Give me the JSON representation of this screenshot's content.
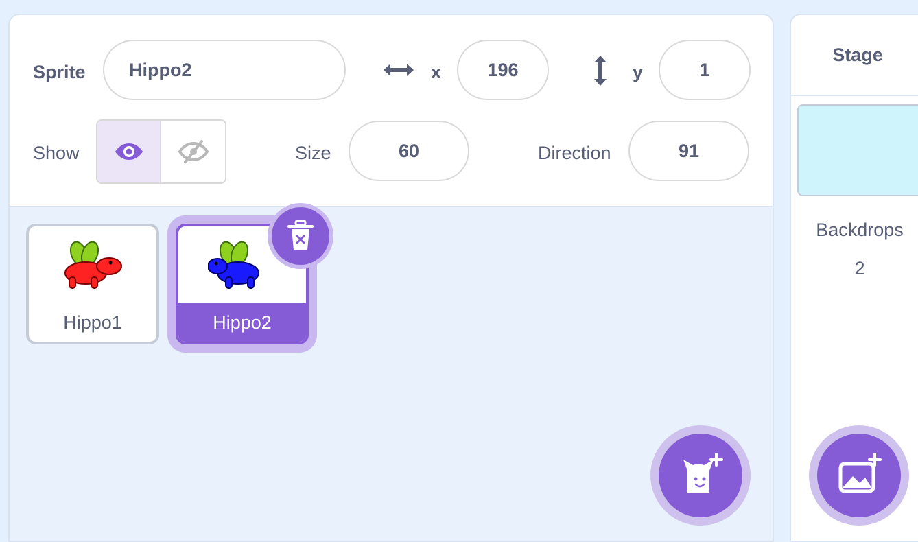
{
  "sprite_info": {
    "sprite_label": "Sprite",
    "sprite_name": "Hippo2",
    "x_label": "x",
    "x_value": "196",
    "y_label": "y",
    "y_value": "1",
    "show_label": "Show",
    "size_label": "Size",
    "size_value": "60",
    "direction_label": "Direction",
    "direction_value": "91"
  },
  "sprites": [
    {
      "name": "Hippo1",
      "color": "#ff2222",
      "selected": false
    },
    {
      "name": "Hippo2",
      "color": "#1a1aff",
      "selected": true
    }
  ],
  "stage": {
    "title": "Stage",
    "backdrops_label": "Backdrops",
    "backdrops_count": "2",
    "backdrop_color": "#cff4fc"
  },
  "colors": {
    "accent": "#855cd6",
    "accent_light": "#c9b8f0",
    "pane_bg": "#e9f1fc",
    "text": "#575e75"
  },
  "icons": {
    "x_axis": "horizontal-arrows-icon",
    "y_axis": "vertical-arrows-icon",
    "show": "eye-icon",
    "hide": "eye-slash-icon",
    "delete": "trash-icon",
    "add_sprite": "cat-plus-icon",
    "add_backdrop": "image-plus-icon"
  }
}
